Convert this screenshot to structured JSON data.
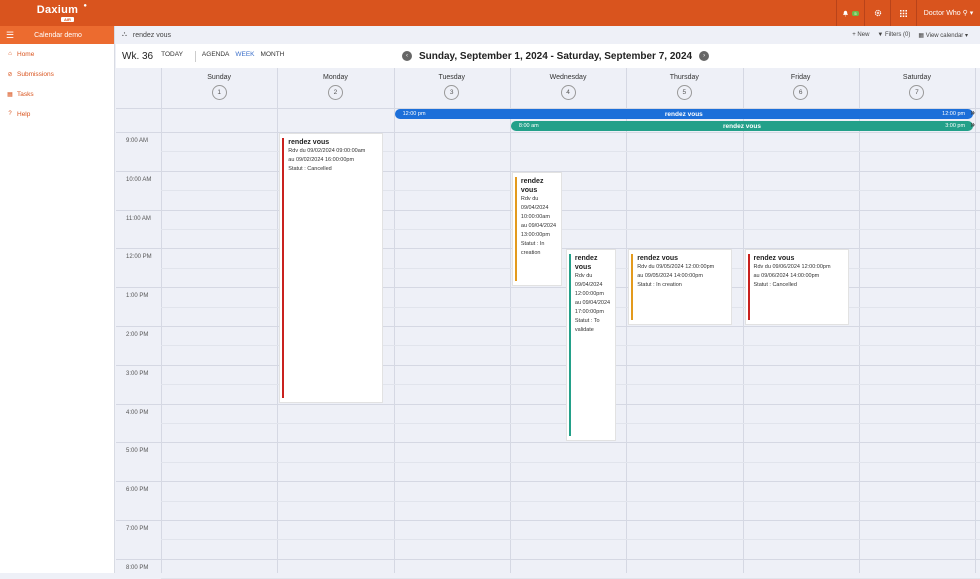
{
  "topbar": {
    "brand": "Daxium",
    "brand_sub": "AIR",
    "notif_count": "5",
    "user": "Doctor Who"
  },
  "sidebar": {
    "title": "Calendar demo",
    "items": [
      {
        "label": "Home",
        "icon": "home-icon"
      },
      {
        "label": "Submissions",
        "icon": "submissions-icon"
      },
      {
        "label": "Tasks",
        "icon": "calendar-icon"
      },
      {
        "label": "Help",
        "icon": "help-icon"
      }
    ]
  },
  "breadcrumb": {
    "label": "rendez vous",
    "new": "+ New",
    "filters": "Filters (0)",
    "view_calendar": "View calendar"
  },
  "toolbar": {
    "week": "Wk. 36",
    "today": "TODAY",
    "agenda": "AGENDA",
    "week_view": "WEEK",
    "month": "MONTH",
    "range": "Sunday, September 1, 2024 - Saturday, September 7, 2024"
  },
  "days": [
    {
      "name": "Sunday",
      "num": "1"
    },
    {
      "name": "Monday",
      "num": "2"
    },
    {
      "name": "Tuesday",
      "num": "3"
    },
    {
      "name": "Wednesday",
      "num": "4"
    },
    {
      "name": "Thursday",
      "num": "5"
    },
    {
      "name": "Friday",
      "num": "6"
    },
    {
      "name": "Saturday",
      "num": "7"
    }
  ],
  "hours": [
    "9:00 AM",
    "10:00 AM",
    "11:00 AM",
    "12:00 PM",
    "1:00 PM",
    "2:00 PM",
    "3:00 PM",
    "4:00 PM",
    "5:00 PM",
    "6:00 PM",
    "7:00 PM",
    "8:00 PM"
  ],
  "allday": [
    {
      "start": "12:00 pm",
      "title": "rendez vous",
      "end": "12:00 pm",
      "color": "#1c6fd9"
    },
    {
      "start": "8:00 am",
      "title": "rendez vous",
      "end": "3:00 pm",
      "color": "#23a089"
    }
  ],
  "more_glyph": "»",
  "events": [
    {
      "title": "rendez vous",
      "l1": "Rdv du 09/02/2024 09:00:00am",
      "l2": "au 09/02/2024 16:00:00pm",
      "l3": "Statut : Cancelled",
      "color": "#c9211e"
    },
    {
      "title": "rendez vous",
      "l1": "Rdv du 09/04/2024 10:00:00am",
      "l2": "au 09/04/2024 13:00:00pm",
      "l3": "Statut : In creation",
      "color": "#e39a1d"
    },
    {
      "title": "rendez vous",
      "l1": "Rdv du 09/04/2024 12:00:00pm",
      "l2": "au 09/04/2024 17:00:00pm",
      "l3": "Statut : To validate",
      "color": "#23a089"
    },
    {
      "title": "rendez vous",
      "l1": "Rdv du 09/05/2024 12:00:00pm",
      "l2": "au 09/05/2024 14:00:00pm",
      "l3": "Statut : In creation",
      "color": "#e39a1d"
    },
    {
      "title": "rendez vous",
      "l1": "Rdv du 09/06/2024 12:00:00pm",
      "l2": "au 09/06/2024 14:00:00pm",
      "l3": "Statut : Cancelled",
      "color": "#c9211e"
    }
  ]
}
